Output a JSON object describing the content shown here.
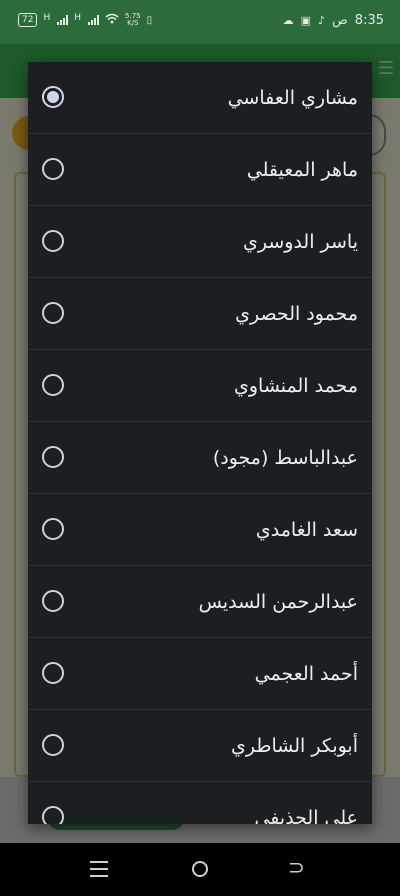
{
  "status_bar": {
    "battery": "72",
    "net_type_1": "H",
    "net_type_2": "H",
    "speed_value": "5.75",
    "speed_unit": "K/S",
    "time": "8:35",
    "ampm": "ص"
  },
  "reciter_dialog": {
    "options": [
      {
        "label": "مشاري العفاسي",
        "selected": true
      },
      {
        "label": "ماهر المعيقلي",
        "selected": false
      },
      {
        "label": "ياسر الدوسري",
        "selected": false
      },
      {
        "label": "محمود الحصري",
        "selected": false
      },
      {
        "label": "محمد المنشاوي",
        "selected": false
      },
      {
        "label": "عبدالباسط (مجود)",
        "selected": false
      },
      {
        "label": "سعد الغامدي",
        "selected": false
      },
      {
        "label": "عبدالرحمن السديس",
        "selected": false
      },
      {
        "label": "أحمد العجمي",
        "selected": false
      },
      {
        "label": "أبوبكر الشاطري",
        "selected": false
      },
      {
        "label": "علي الحذيفي",
        "selected": false
      }
    ]
  },
  "colors": {
    "status_bar": "#2c6b3a",
    "dialog_bg": "#1c1f22",
    "radio_selected": "#cfd8ea"
  },
  "icons": {
    "status": [
      "wifi-icon",
      "cloud-icon",
      "tiktok-icon",
      "notification-icon"
    ],
    "nav": [
      "recents-icon",
      "home-icon",
      "back-icon"
    ]
  }
}
